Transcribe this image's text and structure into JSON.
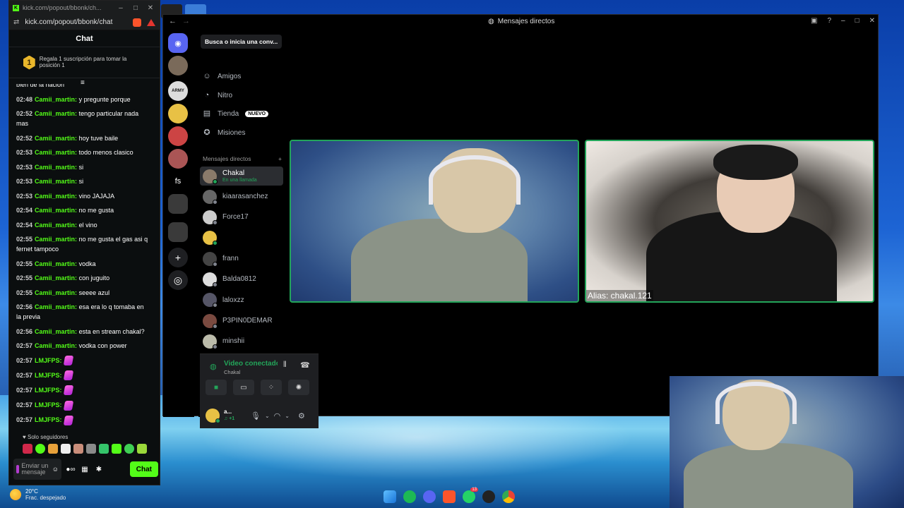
{
  "kick": {
    "window_title": "kick.com/popout/bbonk/ch...",
    "url": "kick.com/popout/bbonk/chat",
    "chat_header": "Chat",
    "promo_badge": "1",
    "promo_text": "Regala 1 suscripción para tomar la posición 1",
    "partial_message": "bien de la nación",
    "messages": [
      {
        "time": "02:48",
        "user": "Camii_martin:",
        "text": "y pregunte porque"
      },
      {
        "time": "02:52",
        "user": "Camii_martin:",
        "text": "tengo particular nada mas"
      },
      {
        "time": "02:52",
        "user": "Camii_martin:",
        "text": "hoy tuve baile"
      },
      {
        "time": "02:53",
        "user": "Camii_martin:",
        "text": "todo menos clasico"
      },
      {
        "time": "02:53",
        "user": "Camii_martin:",
        "text": "si"
      },
      {
        "time": "02:53",
        "user": "Camii_martin:",
        "text": "si"
      },
      {
        "time": "02:53",
        "user": "Camii_martin:",
        "text": "vino JAJAJA"
      },
      {
        "time": "02:54",
        "user": "Camii_martin:",
        "text": "no me gusta"
      },
      {
        "time": "02:54",
        "user": "Camii_martin:",
        "text": "el vino"
      },
      {
        "time": "02:55",
        "user": "Camii_martin:",
        "text": "no me gusta el gas asi q fernet tampoco"
      },
      {
        "time": "02:55",
        "user": "Camii_martin:",
        "text": "vodka"
      },
      {
        "time": "02:55",
        "user": "Camii_martin:",
        "text": "con juguito"
      },
      {
        "time": "02:55",
        "user": "Camii_martin:",
        "text": "seeee azul"
      },
      {
        "time": "02:56",
        "user": "Camii_martin:",
        "text": "esa era lo q tomaba en la previa"
      },
      {
        "time": "02:56",
        "user": "Camii_martin:",
        "text": "esta en stream chakal?"
      },
      {
        "time": "02:57",
        "user": "Camii_martin:",
        "text": "vodka con power"
      },
      {
        "time": "02:57",
        "user": "LMJFPS:",
        "text": ""
      },
      {
        "time": "02:57",
        "user": "LMJFPS:",
        "text": ""
      },
      {
        "time": "02:57",
        "user": "LMJFPS:",
        "text": ""
      },
      {
        "time": "02:57",
        "user": "LMJFPS:",
        "text": ""
      },
      {
        "time": "02:57",
        "user": "LMJFPS:",
        "text": ""
      }
    ],
    "followers_only": "Solo seguidores",
    "input_placeholder": "Enviar un mensaje",
    "send_label": "Chat"
  },
  "discord": {
    "window_title": "Mensajes directos",
    "search_placeholder": "Busca o inicia una conv...",
    "nav": [
      {
        "label": "Amigos",
        "icon": "friends-icon"
      },
      {
        "label": "Nitro",
        "icon": "nitro-icon"
      },
      {
        "label": "Tienda",
        "icon": "shop-icon",
        "badge": "NUEVO"
      },
      {
        "label": "Misiones",
        "icon": "quests-icon"
      }
    ],
    "dm_heading": "Mensajes directos",
    "dm_add": "+",
    "dms": [
      {
        "name": "Chakal",
        "sub": "En una llamada",
        "active": true
      },
      {
        "name": "kiaarasanchez",
        "sub": ""
      },
      {
        "name": "Force17",
        "sub": ""
      },
      {
        "name": "",
        "sub": ""
      },
      {
        "name": "frann",
        "sub": ""
      },
      {
        "name": "Balda0812",
        "sub": ""
      },
      {
        "name": "laloxzz",
        "sub": ""
      },
      {
        "name": "P3PIN0DEMAR",
        "sub": ""
      },
      {
        "name": "minshii",
        "sub": ""
      }
    ],
    "guild_fs_label": "fs",
    "guild_army_label": "ARMY",
    "voice_status": "Video conectado",
    "voice_channel": "Chakal",
    "user_name": "a...",
    "user_sub": "♫ +1",
    "alias_label": "Alias: chakal.121"
  },
  "taskbar": {
    "temp": "20°C",
    "weather": "Frac. despejado",
    "whatsapp_badge": "13"
  },
  "colors": {
    "kick_green": "#53fc18",
    "discord_blurple": "#5865f2",
    "discord_green": "#23a55a"
  }
}
